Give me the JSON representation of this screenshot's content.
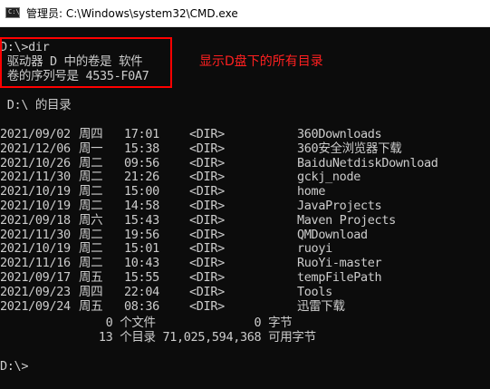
{
  "window": {
    "title": "管理员: C:\\Windows\\system32\\CMD.exe",
    "icon": "terminal-icon"
  },
  "console": {
    "command_line": "D:\\>dir",
    "volume_line": " 驱动器 D 中的卷是 软件",
    "serial_line": " 卷的序列号是 4535-F0A7",
    "directory_header": " D:\\ 的目录",
    "entries": [
      {
        "date": "2021/09/02",
        "day": "周四",
        "time": "17:01",
        "type": "<DIR>",
        "name": "360Downloads"
      },
      {
        "date": "2021/12/06",
        "day": "周一",
        "time": "15:38",
        "type": "<DIR>",
        "name": "360安全浏览器下载"
      },
      {
        "date": "2021/10/26",
        "day": "周二",
        "time": "09:56",
        "type": "<DIR>",
        "name": "BaiduNetdiskDownload"
      },
      {
        "date": "2021/11/30",
        "day": "周二",
        "time": "21:26",
        "type": "<DIR>",
        "name": "gckj_node"
      },
      {
        "date": "2021/10/19",
        "day": "周二",
        "time": "15:00",
        "type": "<DIR>",
        "name": "home"
      },
      {
        "date": "2021/10/19",
        "day": "周二",
        "time": "14:58",
        "type": "<DIR>",
        "name": "JavaProjects"
      },
      {
        "date": "2021/09/18",
        "day": "周六",
        "time": "15:43",
        "type": "<DIR>",
        "name": "Maven Projects"
      },
      {
        "date": "2021/11/30",
        "day": "周二",
        "time": "19:56",
        "type": "<DIR>",
        "name": "QMDownload"
      },
      {
        "date": "2021/10/19",
        "day": "周二",
        "time": "15:01",
        "type": "<DIR>",
        "name": "ruoyi"
      },
      {
        "date": "2021/11/16",
        "day": "周二",
        "time": "10:43",
        "type": "<DIR>",
        "name": "RuoYi-master"
      },
      {
        "date": "2021/09/17",
        "day": "周五",
        "time": "15:55",
        "type": "<DIR>",
        "name": "tempFilePath"
      },
      {
        "date": "2021/09/23",
        "day": "周四",
        "time": "22:04",
        "type": "<DIR>",
        "name": "Tools"
      },
      {
        "date": "2021/09/24",
        "day": "周五",
        "time": "08:36",
        "type": "<DIR>",
        "name": "迅雷下载"
      }
    ],
    "files_summary": "               0 个文件              0 字节",
    "dirs_summary": "              13 个目录 71,025,594,368 可用字节",
    "prompt": "D:\\>"
  },
  "annotation": {
    "text": "显示D盘下的所有目录",
    "color": "#ff0000"
  },
  "colors": {
    "background": "#0c0c0c",
    "foreground": "#cccccc",
    "title_bar": "#ffffff"
  }
}
